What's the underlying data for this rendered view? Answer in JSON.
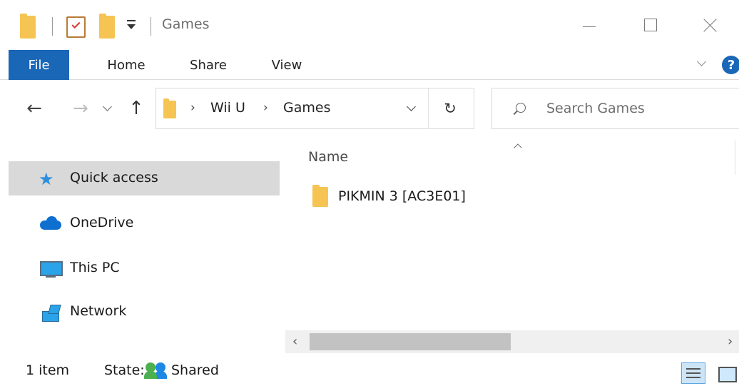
{
  "window": {
    "title": "Games"
  },
  "ribbon": {
    "tabs": [
      {
        "label": "File",
        "active": true
      },
      {
        "label": "Home"
      },
      {
        "label": "Share"
      },
      {
        "label": "View"
      }
    ],
    "help_label": "?"
  },
  "navigation": {
    "back_icon": "arrow-left-icon",
    "forward_icon": "arrow-right-icon",
    "recent_icon": "chevron-down-icon",
    "up_icon": "arrow-up-icon"
  },
  "address": {
    "breadcrumbs": [
      "Wii U",
      "Games"
    ],
    "separator": "›"
  },
  "search": {
    "placeholder": "Search Games",
    "value": ""
  },
  "sidebar": {
    "items": [
      {
        "label": "Quick access",
        "icon": "star-icon",
        "selected": true
      },
      {
        "label": "OneDrive",
        "icon": "cloud-icon"
      },
      {
        "label": "This PC",
        "icon": "computer-icon"
      },
      {
        "label": "Network",
        "icon": "network-icon"
      }
    ]
  },
  "file_list": {
    "column_header": "Name",
    "items": [
      {
        "name": "PIKMIN 3 [AC3E01]",
        "type": "folder"
      }
    ]
  },
  "status_bar": {
    "item_count": "1 item",
    "state_label": "State:",
    "state_value": "Shared"
  },
  "colors": {
    "accent": "#1a66b7",
    "folder": "#f5c453",
    "selection": "#d9d9d9"
  }
}
